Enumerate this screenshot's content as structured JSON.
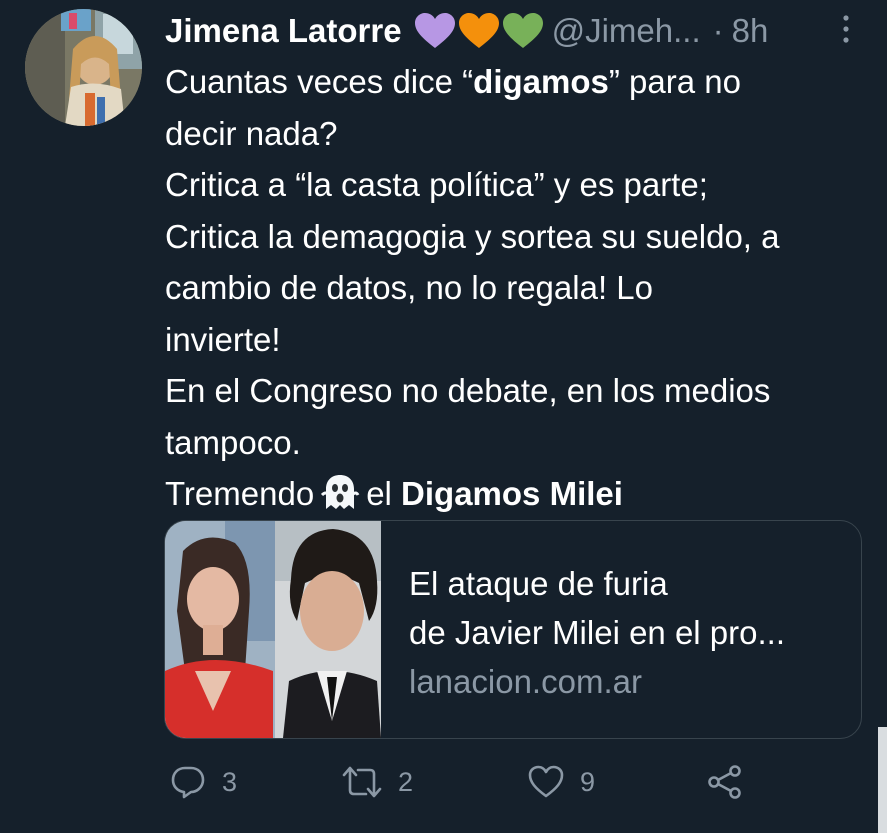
{
  "author": {
    "name": "Jimena Latorre",
    "handle": "@Jimeh...",
    "separator": "·",
    "time": "8h",
    "emoji": [
      "purple-heart",
      "orange-heart",
      "green-heart"
    ]
  },
  "tweet": {
    "line1_pre": "Cuantas veces dice “",
    "line1_bold": "digamos",
    "line1_post": "” para no",
    "line2": "decir nada?",
    "line3": "Critica a “la casta política” y es parte;",
    "line4": "Critica la demagogia y sortea su sueldo, a",
    "line5": "cambio de datos, no lo regala! Lo",
    "line6": "invierte!",
    "line7": "En el Congreso no debate, en los medios",
    "line8": "tampoco.",
    "line9_pre": "Tremendo",
    "line9_emoji": "ghost-icon",
    "line9_mid": "el",
    "line9_bold": "Digamos Milei"
  },
  "card": {
    "title_line1": "El ataque de furia",
    "title_line2": "de Javier Milei en el pro...",
    "domain": "lanacion.com.ar"
  },
  "actions": {
    "reply_count": "3",
    "retweet_count": "2",
    "like_count": "9"
  },
  "colors": {
    "background": "#15202b",
    "text": "#ffffff",
    "secondary": "#8b98a5",
    "border": "#38444d",
    "heart_purple": "#b797e4",
    "heart_orange": "#f4900c",
    "heart_green": "#78b159"
  }
}
